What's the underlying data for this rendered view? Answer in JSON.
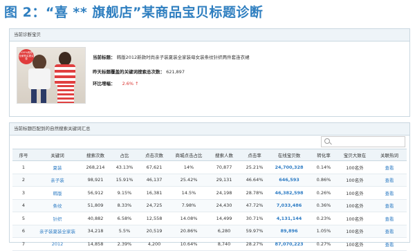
{
  "figure_title": "图 2：“喜 ** 旗舰店”某商品宝贝标题诊断",
  "product_panel": {
    "header": "当前诊断宝贝",
    "photo_badge": "100%纯棉 全家购买更实惠",
    "title_label": "当前标题：",
    "title_value": "韩版2012新款时尚亲子装夏装全家装母女装条纹针织两件套连衣裙",
    "search_volume_label": "昨天标题覆盖的关键词搜索总次数：",
    "search_volume_value": "621,897",
    "growth_label": "环比增幅：",
    "growth_value": "2.6%",
    "growth_arrow": "↑"
  },
  "keyword_panel": {
    "header": "当前标题匹配到的自然搜索关键词汇总",
    "search_placeholder": "",
    "columns": [
      "序号",
      "关键词",
      "搜索次数",
      "占比",
      "点击次数",
      "商城点击占比",
      "搜索人数",
      "点击率",
      "在线宝贝数",
      "转化率",
      "宝贝大致在",
      "关联热词"
    ],
    "rows": [
      {
        "no": "1",
        "keyword": "夏装",
        "searches": "268,214",
        "share": "43.13%",
        "clicks": "67,621",
        "mall_share": "14%",
        "searchers": "70,877",
        "ctr": "25.21%",
        "items": "24,700,328",
        "conv": "0.14%",
        "rank": "100名外",
        "hot": "查看"
      },
      {
        "no": "2",
        "keyword": "亲子装",
        "searches": "98,921",
        "share": "15.91%",
        "clicks": "46,137",
        "mall_share": "25.42%",
        "searchers": "29,131",
        "ctr": "46.64%",
        "items": "646,593",
        "conv": "0.86%",
        "rank": "100名外",
        "hot": "查看"
      },
      {
        "no": "3",
        "keyword": "韩版",
        "searches": "56,912",
        "share": "9.15%",
        "clicks": "16,381",
        "mall_share": "14.5%",
        "searchers": "24,198",
        "ctr": "28.78%",
        "items": "46,382,598",
        "conv": "0.26%",
        "rank": "100名外",
        "hot": "查看"
      },
      {
        "no": "4",
        "keyword": "条纹",
        "searches": "51,809",
        "share": "8.33%",
        "clicks": "24,725",
        "mall_share": "7.98%",
        "searchers": "24,430",
        "ctr": "47.72%",
        "items": "7,033,486",
        "conv": "0.36%",
        "rank": "100名外",
        "hot": "查看"
      },
      {
        "no": "5",
        "keyword": "针织",
        "searches": "40,882",
        "share": "6.58%",
        "clicks": "12,558",
        "mall_share": "14.08%",
        "searchers": "14,499",
        "ctr": "30.71%",
        "items": "4,131,144",
        "conv": "0.23%",
        "rank": "100名外",
        "hot": "查看"
      },
      {
        "no": "6",
        "keyword": "亲子装夏装全家装",
        "searches": "34,218",
        "share": "5.5%",
        "clicks": "20,519",
        "mall_share": "20.86%",
        "searchers": "6,280",
        "ctr": "59.97%",
        "items": "89,896",
        "conv": "1.05%",
        "rank": "100名外",
        "hot": "查看"
      },
      {
        "no": "7",
        "keyword": "2012",
        "searches": "14,858",
        "share": "2.39%",
        "clicks": "4,200",
        "mall_share": "10.64%",
        "searchers": "8,740",
        "ctr": "28.27%",
        "items": "87,070,223",
        "conv": "0.27%",
        "rank": "100名外",
        "hot": "查看"
      }
    ]
  }
}
